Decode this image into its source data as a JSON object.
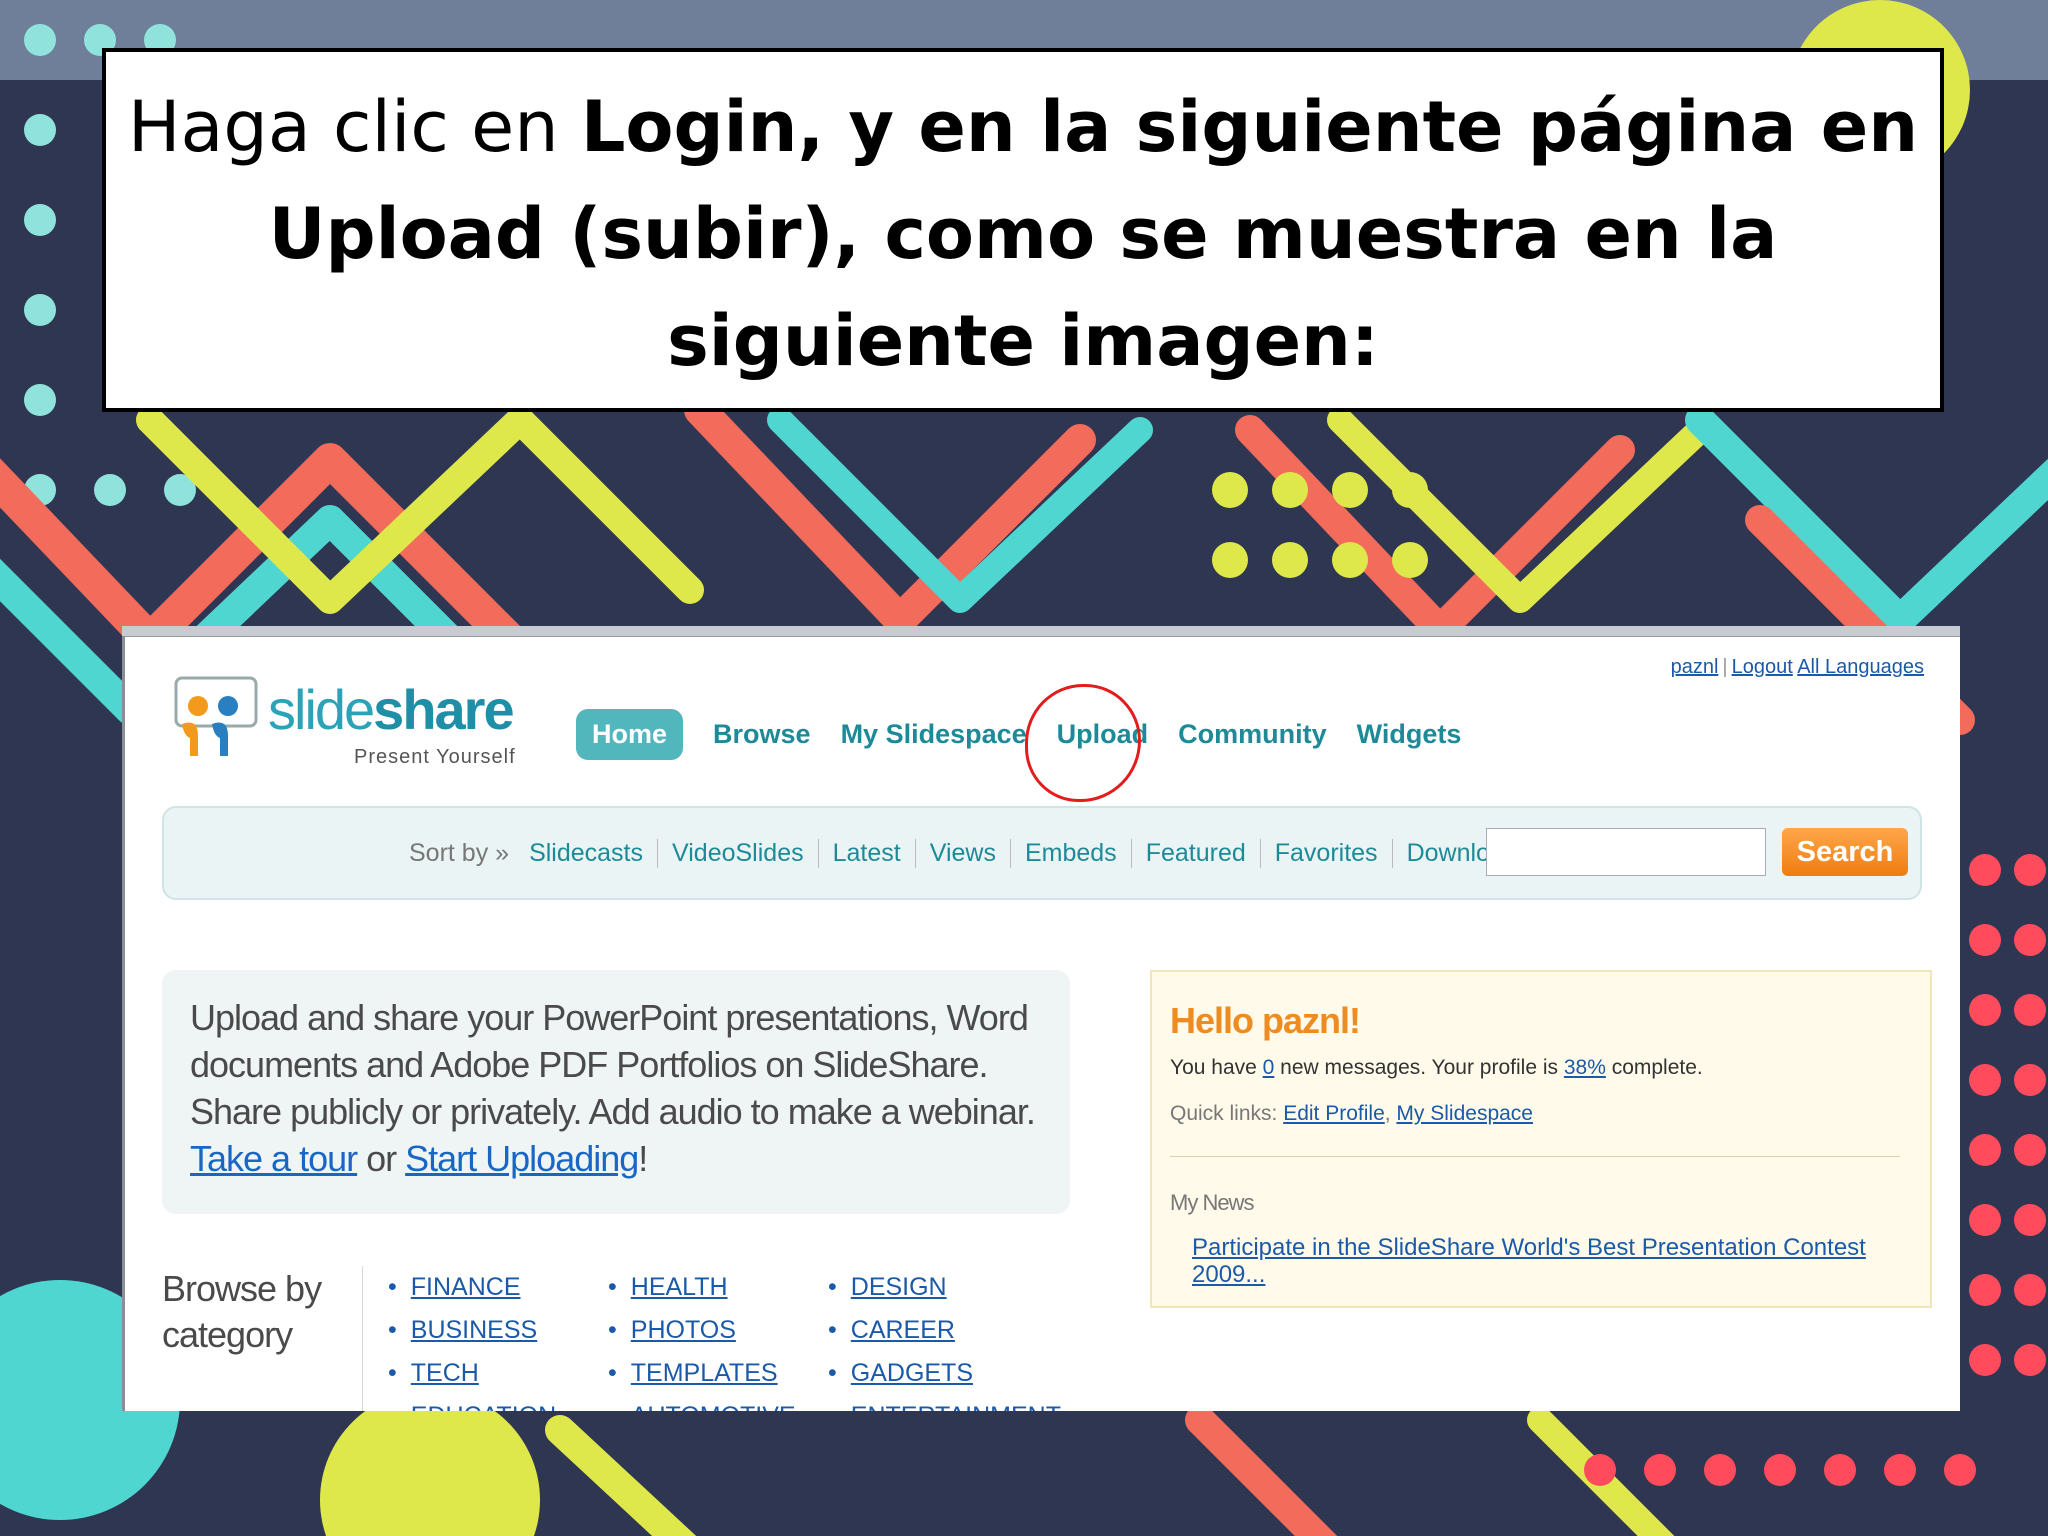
{
  "slide": {
    "caption_normal": "Haga clic en ",
    "caption_bold": "Login, y en la siguiente página en Upload (subir), como se muestra en la siguiente imagen:"
  },
  "site": {
    "logo_slide": "slide",
    "logo_share": "share",
    "tagline": "Present Yourself",
    "top_links": {
      "user": "paznl",
      "logout": "Logout",
      "languages": "All Languages"
    },
    "nav": [
      "Home",
      "Browse",
      "My Slidespace",
      "Upload",
      "Community",
      "Widgets"
    ],
    "sort_label": "Sort by »",
    "sort_links": [
      "Slidecasts",
      "VideoSlides",
      "Latest",
      "Views",
      "Embeds",
      "Featured",
      "Favorites",
      "Downloads"
    ],
    "search_button": "Search",
    "search_value": "",
    "promo": {
      "text_1": "Upload and share your PowerPoint presentations, Word documents and Adobe PDF Portfolios on SlideShare. Share publicly or privately. Add audio to make a webinar. ",
      "tour_link": "Take a tour",
      "or": " or ",
      "upload_link": "Start Uploading",
      "end": "!"
    },
    "browse_title": "Browse by category",
    "categories": [
      [
        "FINANCE",
        "BUSINESS",
        "TECH",
        "EDUCATION"
      ],
      [
        "HEALTH",
        "PHOTOS",
        "TEMPLATES",
        "AUTOMOTIVE"
      ],
      [
        "DESIGN",
        "CAREER",
        "GADGETS",
        "ENTERTAINMENT"
      ]
    ],
    "hello": {
      "title": "Hello paznl!",
      "msg_1": "You have ",
      "msg_count": "0",
      "msg_2": " new messages. Your profile is ",
      "msg_pct": "38%",
      "msg_3": " complete.",
      "quick_label": "Quick links: ",
      "quick_edit": "Edit Profile",
      "quick_sep": ", ",
      "quick_space": "My Slidespace",
      "news_label": "My News",
      "news_link": "Participate in the SlideShare World's Best Presentation Contest 2009..."
    }
  },
  "colors": {
    "accent_teal": "#1e8a98",
    "search_orange": "#ef7d10",
    "hello_orange": "#ee8b21",
    "annotation_red": "#e31c1c"
  }
}
